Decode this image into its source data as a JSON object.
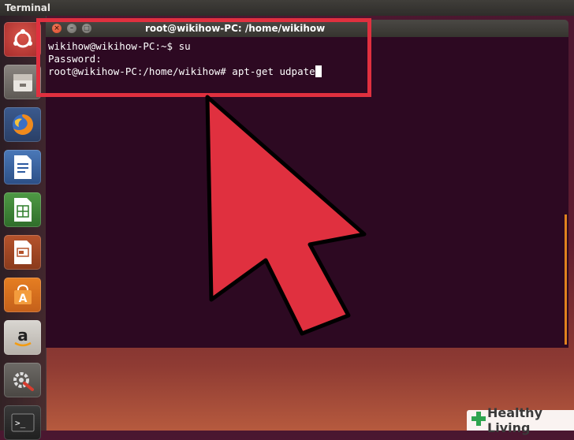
{
  "topbar": {
    "title": "Terminal"
  },
  "launcher": {
    "items": [
      {
        "name": "ubuntu-dash-icon"
      },
      {
        "name": "files-icon"
      },
      {
        "name": "firefox-icon"
      },
      {
        "name": "writer-icon"
      },
      {
        "name": "calc-icon"
      },
      {
        "name": "impress-icon"
      },
      {
        "name": "software-center-icon"
      },
      {
        "name": "amazon-icon"
      },
      {
        "name": "system-settings-icon"
      },
      {
        "name": "terminal-icon"
      }
    ]
  },
  "window": {
    "title": "root@wikihow-PC: /home/wikihow",
    "close_glyph": "×",
    "minimize_glyph": "–",
    "maximize_glyph": "□"
  },
  "terminal": {
    "line1": "wikihow@wikihow-PC:~$ su",
    "line2": "Password:",
    "line3": "root@wikihow-PC:/home/wikihow# apt-get udpate"
  },
  "watermark": {
    "logo_text": "Healthy Living"
  },
  "colors": {
    "highlight": "#e0303f",
    "terminal_bg": "#2d0922",
    "scroll_accent": "#e0821e"
  }
}
